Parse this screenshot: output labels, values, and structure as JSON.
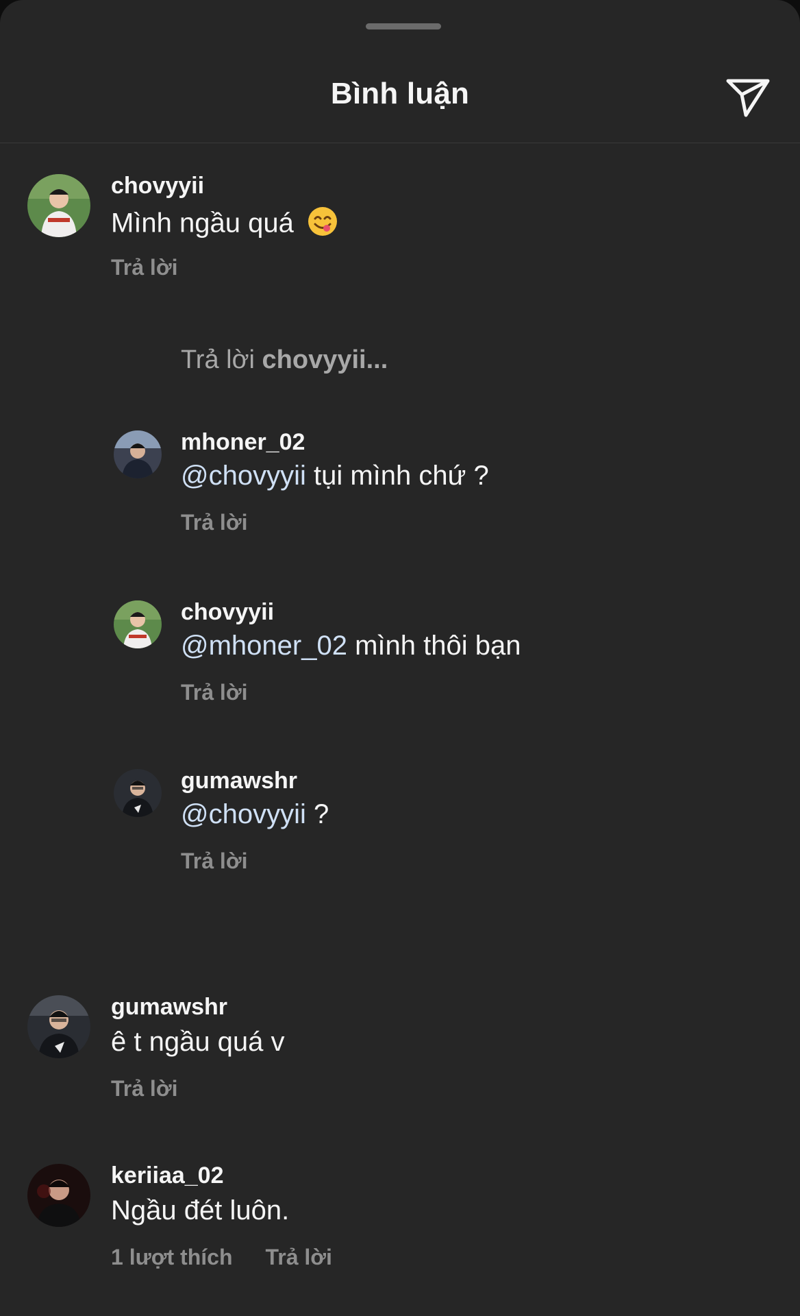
{
  "header": {
    "title": "Bình luận"
  },
  "reply_input": {
    "prefix": "Trả lời",
    "target": "chovyyii..."
  },
  "comments": [
    {
      "username": "chovyyii",
      "text": "Mình ngầu quá",
      "emoji": "savoring-face-emoji",
      "actions": {
        "reply": "Trả lời"
      }
    },
    {
      "username": "mhoner_02",
      "mention": "@chovyyii",
      "text": " tụi mình chứ ?",
      "actions": {
        "reply": "Trả lời"
      }
    },
    {
      "username": "chovyyii",
      "mention": "@mhoner_02",
      "text": " mình thôi bạn",
      "actions": {
        "reply": "Trả lời"
      }
    },
    {
      "username": "gumawshr",
      "mention": "@chovyyii",
      "text": " ?",
      "actions": {
        "reply": "Trả lời"
      }
    },
    {
      "username": "gumawshr",
      "text": "ê t ngầu quá v",
      "actions": {
        "reply": "Trả lời"
      }
    },
    {
      "username": "keriiaa_02",
      "text": "Ngầu đét luôn.",
      "actions": {
        "likes": "1 lượt thích",
        "reply": "Trả lời"
      }
    }
  ],
  "colors": {
    "background": "#262626",
    "text": "#f5f5f5",
    "muted": "#8e8e8e",
    "mention": "#cfe0f5"
  }
}
